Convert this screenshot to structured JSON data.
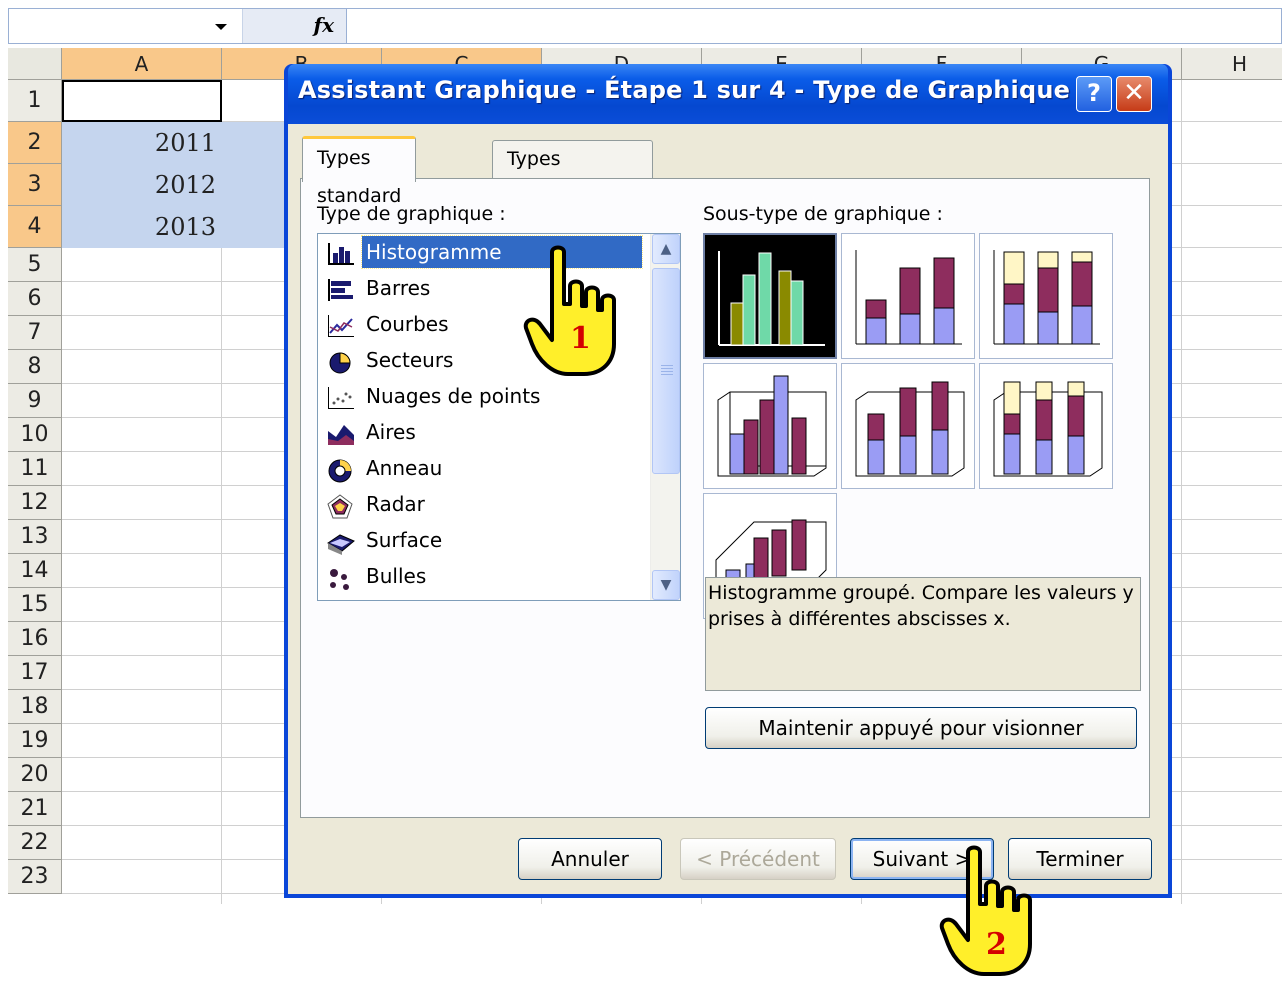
{
  "spreadsheet": {
    "fx_label": "fx",
    "columns": [
      "A",
      "B",
      "C",
      "D",
      "E",
      "F",
      "G",
      "H"
    ],
    "rows": [
      "1",
      "2",
      "3",
      "4",
      "5",
      "6",
      "7",
      "8",
      "9",
      "10",
      "11",
      "12",
      "13",
      "14",
      "15",
      "16",
      "17",
      "18",
      "19",
      "20",
      "21",
      "22",
      "23"
    ],
    "cells_A": [
      "",
      "2011",
      "2012",
      "2013"
    ]
  },
  "dialog": {
    "title": "Assistant Graphique - Étape 1 sur 4 - Type de Graphique",
    "help_button": "?",
    "close_button": "✕",
    "tabs": [
      "Types standard",
      "Types personnalisés"
    ],
    "chart_type_label": "Type de graphique :",
    "subtype_label": "Sous-type de graphique :",
    "chart_types": [
      {
        "label": "Histogramme",
        "icon": "column-chart-icon",
        "selected": true
      },
      {
        "label": "Barres",
        "icon": "bar-chart-icon"
      },
      {
        "label": "Courbes",
        "icon": "line-chart-icon"
      },
      {
        "label": "Secteurs",
        "icon": "pie-chart-icon"
      },
      {
        "label": "Nuages de points",
        "icon": "scatter-chart-icon"
      },
      {
        "label": "Aires",
        "icon": "area-chart-icon"
      },
      {
        "label": "Anneau",
        "icon": "doughnut-chart-icon"
      },
      {
        "label": "Radar",
        "icon": "radar-chart-icon"
      },
      {
        "label": "Surface",
        "icon": "surface-chart-icon"
      },
      {
        "label": "Bulles",
        "icon": "bubble-chart-icon"
      }
    ],
    "description": "Histogramme groupé. Compare les valeurs y prises à différentes abscisses x.",
    "preview_button": "Maintenir appuyé pour visionner",
    "buttons": {
      "cancel": "Annuler",
      "previous": "< Précédent",
      "next": "Suivant >",
      "finish": "Terminer"
    },
    "colors": {
      "selection": "#316ac5",
      "bar_purple": "#8e2d5e",
      "bar_lavender": "#9a9cf4",
      "bar_cream": "#fff6c6",
      "bar_green": "#6fd9a8",
      "bar_olive": "#8a8a00"
    }
  },
  "annotations": {
    "step1": "1",
    "step2": "2"
  }
}
